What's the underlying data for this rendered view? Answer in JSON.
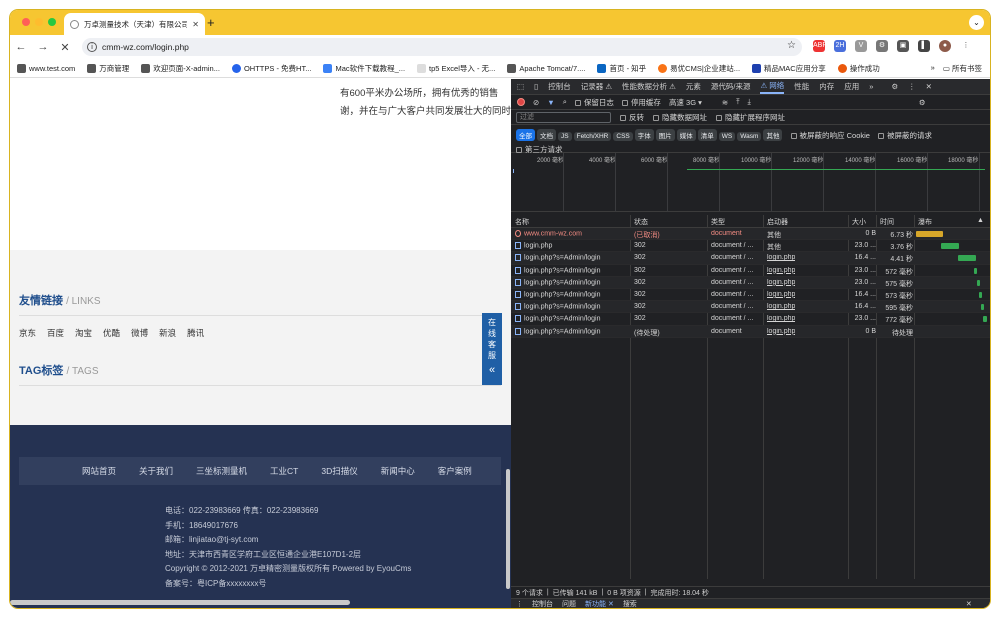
{
  "browser": {
    "tab_title": "万卓测量技术（天津）有限公司",
    "url": "cmm-wz.com/login.php",
    "bookmarks": [
      "www.test.com",
      "万商管理",
      "欢迎页面-X-admin...",
      "OHTTPS - 免费HT...",
      "Mac软件下载教程_...",
      "tp5 Excel导入 - 无...",
      "Apache Tomcat/7....",
      "首页 - 知乎",
      "易优CMS|企业建站...",
      "精品MAC应用分享",
      "操作成功"
    ],
    "bookmark_more": "»",
    "all_bookmarks": "所有书签"
  },
  "page": {
    "about_lines": [
      "有600平米办公场所，拥有优秀的销售",
      "谢，并在与广大客户共同发展壮大的同时"
    ],
    "links_title": "友情链接",
    "links_sub": "/ LINKS",
    "links": [
      "京东",
      "百度",
      "淘宝",
      "优酷",
      "微博",
      "新浪",
      "腾讯"
    ],
    "tags_title": "TAG标签",
    "tags_sub": "/ TAGS",
    "kefu": [
      "在",
      "线",
      "客",
      "服"
    ],
    "kefu_arrow": "«",
    "footer_nav": [
      "网站首页",
      "关于我们",
      "三坐标测量机",
      "工业CT",
      "3D扫描仪",
      "新闻中心",
      "客户案例"
    ],
    "footer_info": [
      "电话：022-23983669 传真：022-23983669",
      "手机：18649017676",
      "邮箱：linjiatao@tj-syt.com",
      "地址：天津市西青区学府工业区恒通企业港E107D1-2层",
      "Copyright © 2012-2021 万卓精密测量版权所有 Powered by EyouCms",
      "备案号：粤ICP备xxxxxxxx号"
    ]
  },
  "devtools": {
    "tabs": [
      "控制台",
      "记录器 ⚠",
      "性能数据分析 ⚠",
      "元素",
      "源代码/来源",
      "⚠ 网络",
      "性能",
      "内存",
      "应用"
    ],
    "toolbar": {
      "preserve_log": "保留日志",
      "disable_cache": "停用缓存",
      "throttle": "高速 3G"
    },
    "filter_placeholder": "过滤",
    "invert": "反转",
    "hide_data": "隐藏数据网址",
    "hide_ext": "隐藏扩展程序网址",
    "type_chips": [
      "全部",
      "文档",
      "JS",
      "Fetch/XHR",
      "CSS",
      "字体",
      "图片",
      "媒体",
      "清单",
      "WS",
      "Wasm",
      "其他"
    ],
    "blocked_cookie": "被屏蔽的响应 Cookie",
    "blocked_req": "被屏蔽的请求",
    "third_party": "第三方请求",
    "ticks": [
      "2000 毫秒",
      "4000 毫秒",
      "6000 毫秒",
      "8000 毫秒",
      "10000 毫秒",
      "12000 毫秒",
      "14000 毫秒",
      "16000 毫秒",
      "18000 毫秒"
    ],
    "headers": [
      "名称",
      "状态",
      "类型",
      "启动器",
      "大小",
      "时间",
      "瀑布"
    ],
    "rows": [
      {
        "name": "www.cmm-wz.com",
        "status": "(已取消)",
        "type": "document",
        "initiator": "其他",
        "size": "0 B",
        "time": "6.73 秒",
        "error": true
      },
      {
        "name": "login.php",
        "status": "302",
        "type": "document / ...",
        "initiator": "其他",
        "size": "23.0 ...",
        "time": "3.76 秒"
      },
      {
        "name": "login.php?s=Admin/login",
        "status": "302",
        "type": "document / ...",
        "initiator": "login.php",
        "size": "16.4 ...",
        "time": "4.41 秒"
      },
      {
        "name": "login.php?s=Admin/login",
        "status": "302",
        "type": "document / ...",
        "initiator": "login.php",
        "size": "23.0 ...",
        "time": "572 毫秒"
      },
      {
        "name": "login.php?s=Admin/login",
        "status": "302",
        "type": "document / ...",
        "initiator": "login.php",
        "size": "23.0 ...",
        "time": "575 毫秒"
      },
      {
        "name": "login.php?s=Admin/login",
        "status": "302",
        "type": "document / ...",
        "initiator": "login.php",
        "size": "16.4 ...",
        "time": "573 毫秒"
      },
      {
        "name": "login.php?s=Admin/login",
        "status": "302",
        "type": "document / ...",
        "initiator": "login.php",
        "size": "16.4 ...",
        "time": "595 毫秒"
      },
      {
        "name": "login.php?s=Admin/login",
        "status": "302",
        "type": "document / ...",
        "initiator": "login.php",
        "size": "23.0 ...",
        "time": "772 毫秒"
      },
      {
        "name": "login.php?s=Admin/login",
        "status": "(待处理)",
        "type": "document",
        "initiator": "login.php",
        "size": "0 B",
        "time": "待处理"
      }
    ],
    "status_bar": [
      "9 个请求",
      "已传输 141 kB",
      "0 B 项资源",
      "完成用时: 18.04 秒"
    ],
    "drawer_tabs": [
      "控制台",
      "问题",
      "新功能",
      "搜索"
    ]
  },
  "colors": {
    "tabbar": "#f6c631",
    "footer": "#253252",
    "link_blue": "#1f4e8c",
    "dt_bg": "#202124",
    "accent": "#8ab4f8"
  }
}
